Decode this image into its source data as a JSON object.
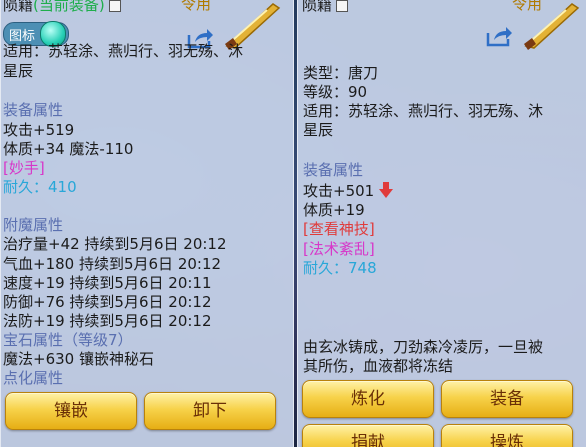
{
  "left": {
    "title_prefix": "陨籍",
    "title_suffix": "(当前装备)",
    "usage_tag": "令用",
    "toggle_label": "图标",
    "applicable": "适用：苏轻涂、燕归行、羽无殇、沐",
    "applicable_cont": "星辰",
    "attr_header": "装备属性",
    "attr_lines": [
      "攻击+519",
      "体质+34 魔法-110"
    ],
    "skill": "[妙手]",
    "durability": "耐久：410",
    "enchant_header": "附魔属性",
    "enchant_lines": [
      "治疗量+42 持续到5月6日 20:12",
      "气血+180 持续到5月6日 20:12",
      "速度+19 持续到5月6日 20:11",
      "防御+76 持续到5月6日 20:12",
      "法防+19 持续到5月6日 20:12"
    ],
    "gem_header": "宝石属性（等级7）",
    "gem_line": "魔法+630 镶嵌神秘石",
    "refine_header": "点化属性",
    "buttons": [
      "镶嵌",
      "卸下"
    ]
  },
  "right": {
    "title_prefix": "陨籍",
    "usage_tag": "令用",
    "type_line": "类型：唐刀",
    "level_line": "等级：90",
    "applicable": "适用：苏轻涂、燕归行、羽无殇、沐",
    "applicable_cont": "星辰",
    "attr_header": "装备属性",
    "attack": "攻击+501",
    "con": "体质+19",
    "check_skill": "[查看神技]",
    "spell": "[法术紊乱]",
    "durability": "耐久：748",
    "desc_1": "由玄冰铸成，刀劲森冷凌厉，一旦被",
    "desc_2": "其所伤，血液都将冻结",
    "buttons": [
      "炼化",
      "装备",
      "捐献",
      "操炼"
    ]
  },
  "icons": [
    "share-icon",
    "weapon-icon",
    "checkbox-icon",
    "toggle-icon",
    "down-arrow-icon"
  ],
  "colors": {
    "header": "#5a6fb0",
    "durability": "#28a7d8",
    "skill": "#d737c9",
    "down_arrow": "#e03b3b",
    "button": "#f7d24a"
  }
}
